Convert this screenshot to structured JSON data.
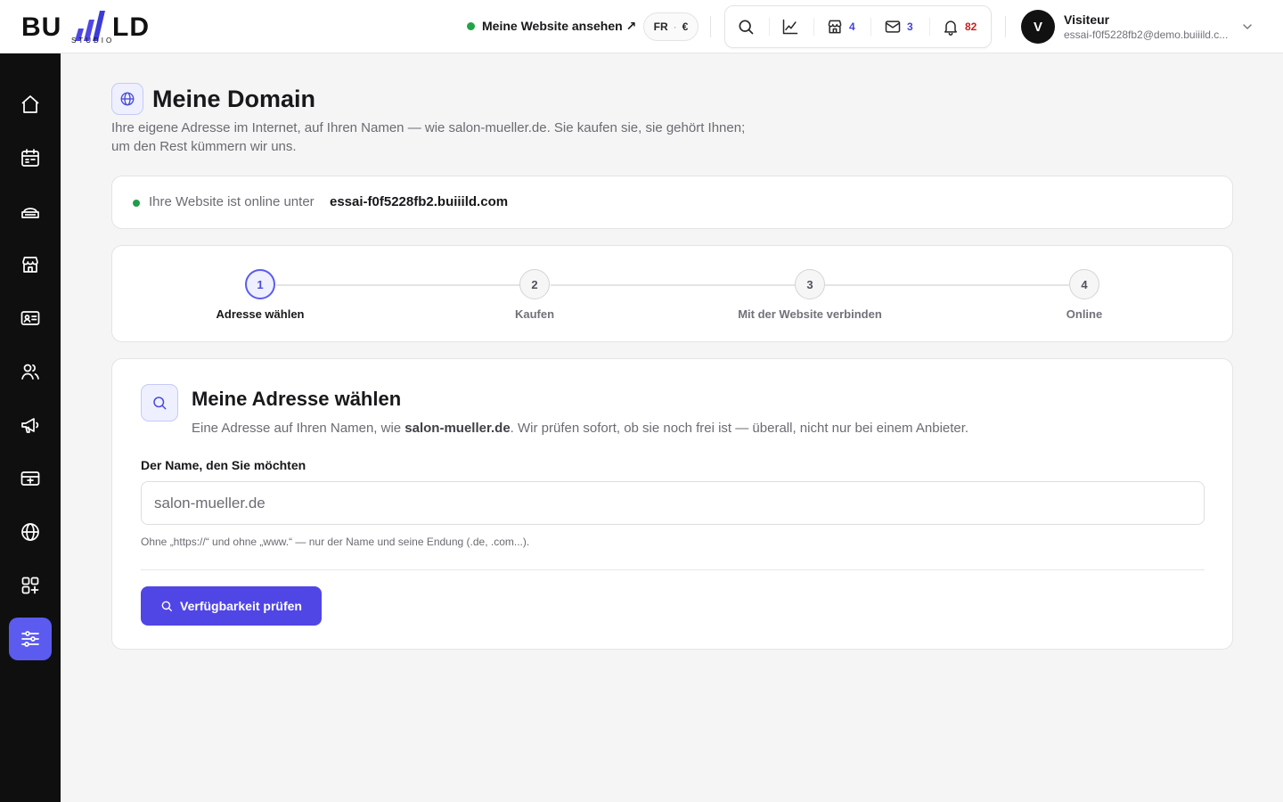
{
  "brand": {
    "word_left": "BU",
    "word_right": "LD",
    "sub": "STUDIO"
  },
  "header": {
    "site_link": "Meine Website ansehen ↗",
    "lang": "FR",
    "currency": "€",
    "tools": {
      "search_icon": "search-icon",
      "stats_icon": "chart-line-icon",
      "shop_icon": "store-icon",
      "shop_count": "4",
      "mail_icon": "mail-icon",
      "mail_count": "3",
      "bell_icon": "bell-icon",
      "bell_count": "82"
    },
    "user": {
      "initial": "V",
      "name": "Visiteur",
      "email": "essai-f0f5228fb2@demo.buiiild.c..."
    }
  },
  "sidebar": {
    "items": [
      {
        "icon": "home-icon"
      },
      {
        "icon": "calendar-icon"
      },
      {
        "icon": "services-icon"
      },
      {
        "icon": "store-icon"
      },
      {
        "icon": "contact-card-icon"
      },
      {
        "icon": "users-icon"
      },
      {
        "icon": "megaphone-icon"
      },
      {
        "icon": "payment-card-icon"
      },
      {
        "icon": "globe-icon"
      },
      {
        "icon": "apps-icon"
      },
      {
        "icon": "settings-sliders-icon",
        "active": true
      }
    ]
  },
  "page": {
    "title": "Meine Domain",
    "description": "Ihre eigene Adresse im Internet, auf Ihren Namen — wie salon-mueller.de. Sie kaufen sie, sie gehört Ihnen; um den Rest kümmern wir uns."
  },
  "status": {
    "text": "Ihre Website ist online unter",
    "domain": "essai-f0f5228fb2.buiiild.com"
  },
  "steps": [
    {
      "num": "1",
      "label": "Adresse wählen",
      "active": true
    },
    {
      "num": "2",
      "label": "Kaufen"
    },
    {
      "num": "3",
      "label": "Mit der Website verbinden"
    },
    {
      "num": "4",
      "label": "Online"
    }
  ],
  "form": {
    "title": "Meine Adresse wählen",
    "desc_before": "Eine Adresse auf Ihren Namen, wie ",
    "desc_bold": "salon-mueller.de",
    "desc_after": ". Wir prüfen sofort, ob sie noch frei ist — überall, nicht nur bei einem Anbieter.",
    "field_label": "Der Name, den Sie möchten",
    "placeholder": "salon-mueller.de",
    "value": "",
    "hint": "Ohne „https://“ und ohne „www.“ — nur der Name und seine Endung (.de, .com...).",
    "button": "Verfügbarkeit prüfen"
  },
  "colors": {
    "accent": "#5046e5",
    "sidebar_active": "#5b5bf0",
    "online_green": "#22a447",
    "count_blue": "#4343d8",
    "count_red": "#c81e1e"
  }
}
